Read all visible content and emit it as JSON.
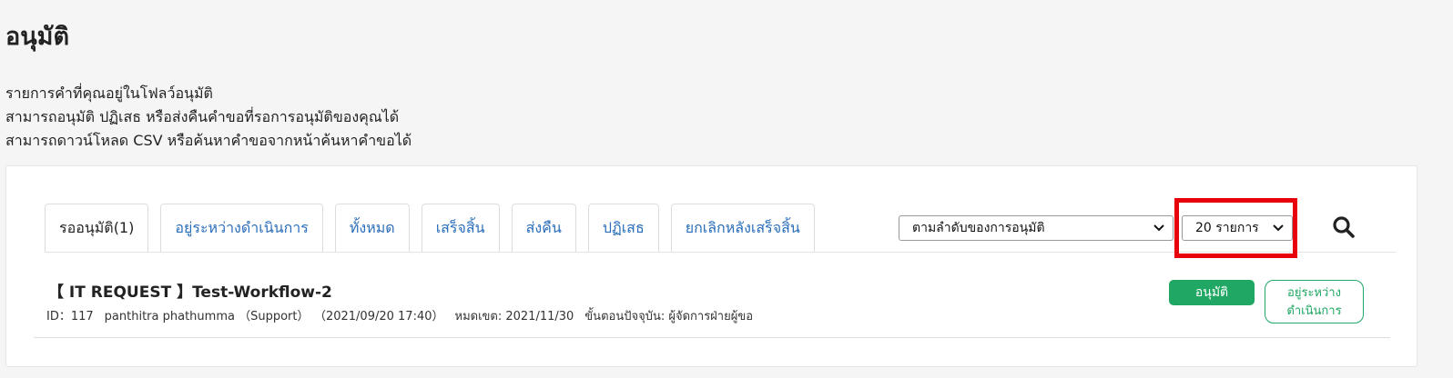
{
  "page": {
    "title": "อนุมัติ",
    "description_lines": [
      "รายการคำที่คุณอยู่ในโฟลว์อนุมัติ",
      "สามารถอนุมัติ ปฏิเสธ หรือส่งคืนคำขอที่รอการอนุมัติของคุณได้",
      "สามารถดาวน์โหลด CSV หรือค้นหาคำขอจากหน้าค้นหาคำขอได้"
    ]
  },
  "tabs": [
    {
      "label": "รออนุมัติ(1)",
      "active": true
    },
    {
      "label": "อยู่ระหว่างดำเนินการ",
      "active": false
    },
    {
      "label": "ทั้งหมด",
      "active": false
    },
    {
      "label": "เสร็จสิ้น",
      "active": false
    },
    {
      "label": "ส่งคืน",
      "active": false
    },
    {
      "label": "ปฏิเสธ",
      "active": false
    },
    {
      "label": "ยกเลิกหลังเสร็จสิ้น",
      "active": false
    }
  ],
  "controls": {
    "sort_select": "ตามลำดับของการอนุมัติ",
    "count_select": "20 รายการ",
    "search_icon": "search-icon",
    "highlight_color": "#e8000b"
  },
  "request": {
    "title": "【 IT REQUEST 】Test-Workflow-2",
    "id": "ID：117",
    "requester": "panthitra phathumma （Support）",
    "submitted": "（2021/09/20 17:40）",
    "deadline": "หมดเขต: 2021/11/30",
    "current_step": "ขั้นตอนปัจจุบัน: ผู้จัดการฝ่ายผู้ขอ",
    "approve_label": "อนุมัติ",
    "status_line1": "อยู่ระหว่าง",
    "status_line2": "ดำเนินการ",
    "accent_color": "#1fa763"
  }
}
